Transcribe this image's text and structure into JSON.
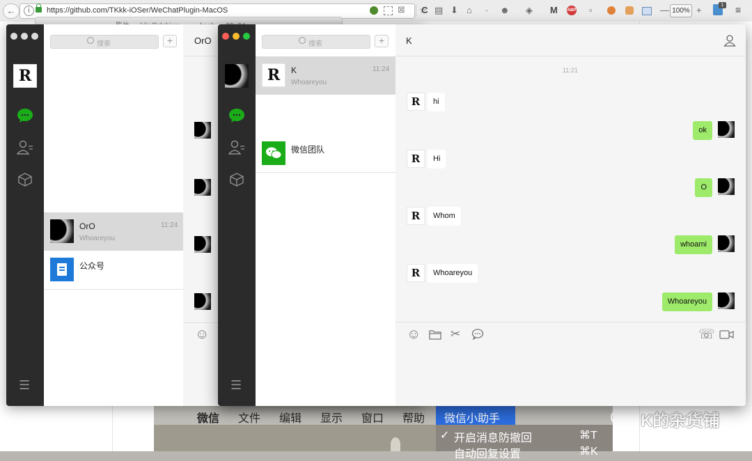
{
  "browser": {
    "url": "https://github.com/TKkk-iOSer/WeChatPlugin-MacOS",
    "zoom": "100%",
    "notification_count": "1",
    "back_glyph": "←",
    "reload_glyph": "C",
    "menu_glyph": "≡",
    "info_glyph": "i",
    "toolbar_icons": [
      "star-icon",
      "reading-list-icon",
      "download-icon",
      "home-icon",
      "dot-icon",
      "mask-extension-icon",
      "shield-extension-icon",
      "m-extension-icon",
      "abp-extension-icon",
      "box-extension-icon",
      "orange-extension-icon",
      "fox-extension-icon",
      "screenshot-extension-icon"
    ],
    "zoom_minus": "—",
    "zoom_plus": "+"
  },
  "terminal": {
    "title": "影片 — kilo@debian: ~ — -bash — 80×24"
  },
  "menubar": {
    "items": [
      "微信",
      "文件",
      "编辑",
      "显示",
      "窗口",
      "帮助",
      "微信小助手"
    ],
    "dropdown": [
      {
        "check": "✓",
        "label": "开启消息防撤回",
        "shortcut": "⌘T"
      },
      {
        "check": "",
        "label": "自动回复设置",
        "shortcut": "⌘K"
      }
    ]
  },
  "watermark": {
    "text": "K的杂货铺"
  },
  "window_a": {
    "search_placeholder": "搜索",
    "plus": "+",
    "header_title": "OrO",
    "contacts": [
      {
        "name": "OrO",
        "subtitle": "Whoareyou",
        "time": "11:24"
      },
      {
        "name": "公众号",
        "subtitle": "",
        "time": ""
      }
    ],
    "sidebar_menu_glyph": "☰",
    "emoji_glyph": "☺"
  },
  "window_b": {
    "search_placeholder": "搜索",
    "plus": "+",
    "header_title": "K",
    "contacts": [
      {
        "name": "K",
        "subtitle": "Whoareyou",
        "time": "11:24"
      },
      {
        "name": "微信团队",
        "subtitle": "",
        "time": ""
      }
    ],
    "sidebar_menu_glyph": "☰",
    "avatar_letter": "R",
    "chat": {
      "timestamp": "11:21",
      "messages": [
        {
          "dir": "in",
          "text": "hi"
        },
        {
          "dir": "out",
          "text": "ok"
        },
        {
          "dir": "in",
          "text": "Hi"
        },
        {
          "dir": "out",
          "text": "O"
        },
        {
          "dir": "in",
          "text": "Whom"
        },
        {
          "dir": "out",
          "text": "whoami"
        },
        {
          "dir": "in",
          "text": "Whoareyou"
        },
        {
          "dir": "out",
          "text": "Whoareyou"
        }
      ],
      "toolbar_glyphs": {
        "emoji": "☺",
        "scissors": "✂",
        "phone": "☏"
      }
    }
  },
  "colors": {
    "sidebar": "#2b2b2b",
    "wechat_green": "#1aad19",
    "bubble_out": "#9eea6a",
    "close_red": "#fc5f57",
    "min_yellow": "#fdbc2e",
    "max_green": "#28c840",
    "menu_highlight": "#2d6ee0",
    "official_blue": "#1d7ad8"
  }
}
